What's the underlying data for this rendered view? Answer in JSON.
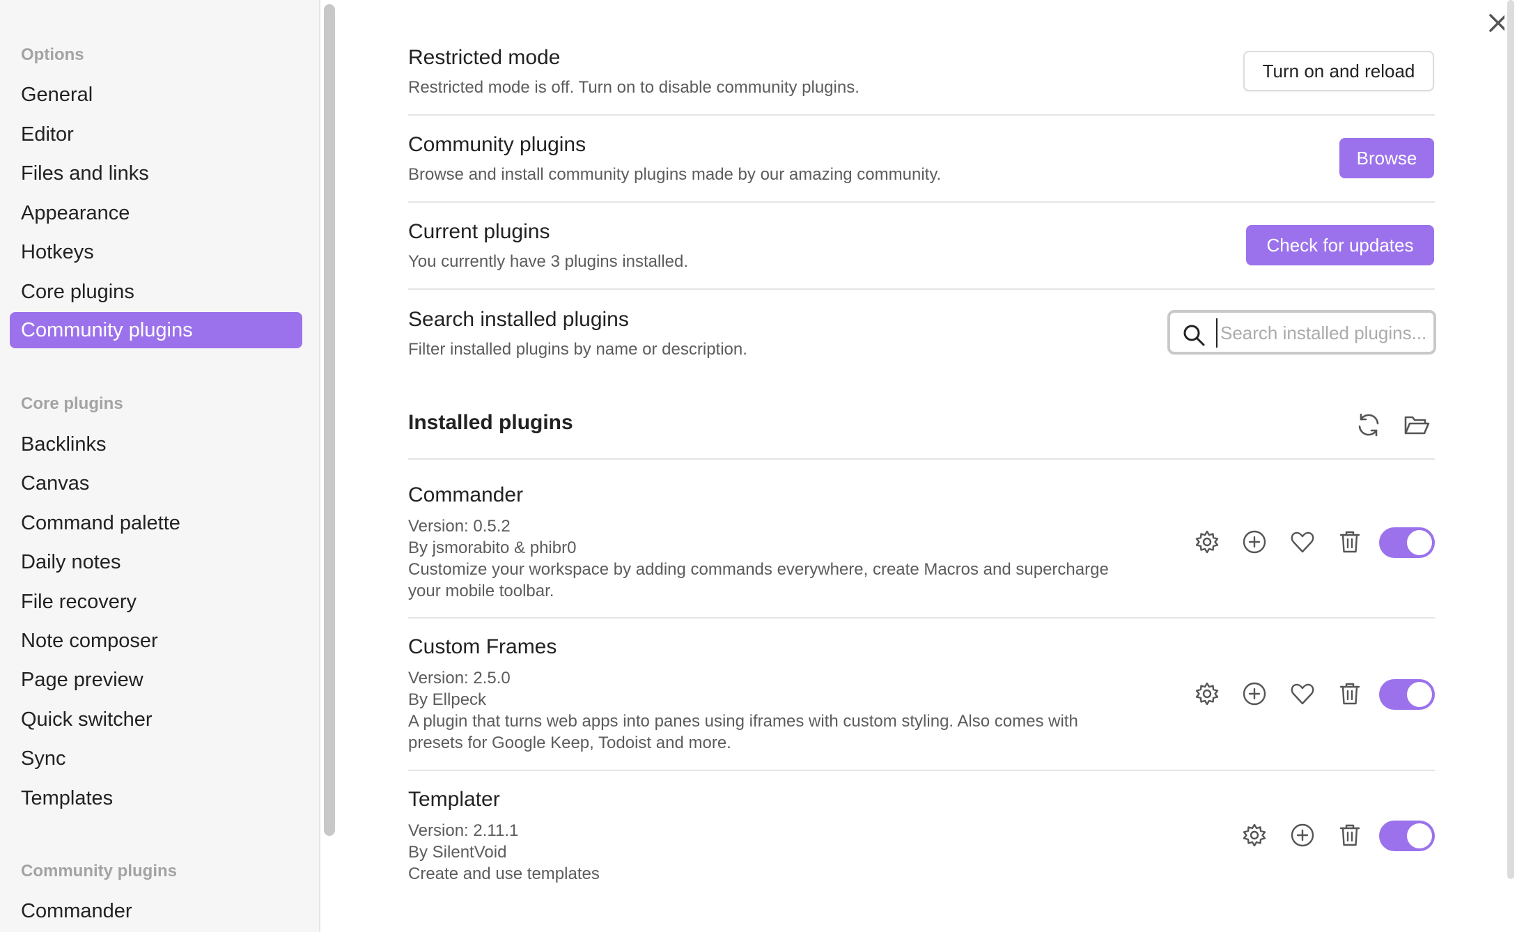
{
  "sidebar": {
    "sections": [
      {
        "heading": "Options",
        "items": [
          "General",
          "Editor",
          "Files and links",
          "Appearance",
          "Hotkeys",
          "Core plugins",
          "Community plugins"
        ]
      },
      {
        "heading": "Core plugins",
        "items": [
          "Backlinks",
          "Canvas",
          "Command palette",
          "Daily notes",
          "File recovery",
          "Note composer",
          "Page preview",
          "Quick switcher",
          "Sync",
          "Templates"
        ]
      },
      {
        "heading": "Community plugins",
        "items": [
          "Commander"
        ]
      }
    ],
    "active_item": "Community plugins"
  },
  "settings": {
    "restricted_mode": {
      "name": "Restricted mode",
      "description": "Restricted mode is off. Turn on to disable community plugins.",
      "button": "Turn on and reload"
    },
    "community_plugins": {
      "name": "Community plugins",
      "description": "Browse and install community plugins made by our amazing community.",
      "button": "Browse"
    },
    "current_plugins": {
      "name": "Current plugins",
      "description": "You currently have 3 plugins installed.",
      "button": "Check for updates"
    },
    "search": {
      "name": "Search installed plugins",
      "description": "Filter installed plugins by name or description.",
      "placeholder": "Search installed plugins..."
    }
  },
  "installed": {
    "title": "Installed plugins",
    "plugins": [
      {
        "name": "Commander",
        "version": "Version: 0.5.2",
        "author": "By jsmorabito & phibr0",
        "description_line1": "Customize your workspace by adding commands everywhere, create Macros and supercharge",
        "description_line2": "your mobile toolbar.",
        "enabled": true
      },
      {
        "name": "Custom Frames",
        "version": "Version: 2.5.0",
        "author": "By Ellpeck",
        "description_line1": "A plugin that turns web apps into panes using iframes with custom styling. Also comes with",
        "description_line2": "presets for Google Keep, Todoist and more.",
        "enabled": true
      },
      {
        "name": "Templater",
        "version": "Version: 2.11.1",
        "author": "By SilentVoid",
        "description_line1": "Create and use templates",
        "enabled": true
      }
    ]
  },
  "colors": {
    "accent": "#9b72ec",
    "sidebar_bg": "#f6f6f6",
    "muted_text": "#5c5c5c",
    "heading_text": "#a3a3a3"
  }
}
